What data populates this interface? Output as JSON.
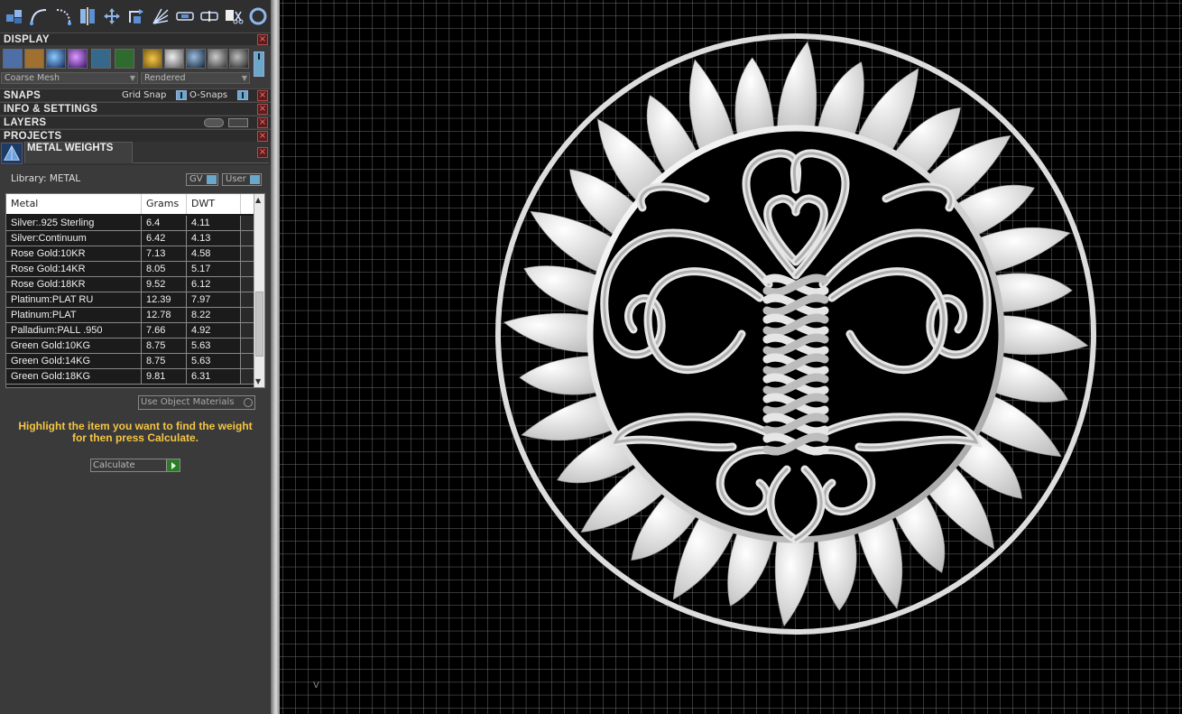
{
  "toolbar": {
    "icons": [
      "cubes-icon",
      "arc-icon",
      "curve-icon",
      "mirror-icon",
      "move-icon",
      "rotate-icon",
      "fan-icon",
      "link-icon",
      "unlink-icon",
      "scissors-icon",
      "circle-icon"
    ]
  },
  "display": {
    "title": "DISPLAY",
    "mesh_select": "Coarse Mesh",
    "render_select": "Rendered"
  },
  "snaps": {
    "title": "SNAPS",
    "grid_snap": "Grid Snap",
    "o_snaps": "O-Snaps"
  },
  "info": {
    "title": "INFO & SETTINGS"
  },
  "layers": {
    "title": "LAYERS"
  },
  "projects": {
    "title": "PROJECTS"
  },
  "metal_weights": {
    "title": "METAL WEIGHTS",
    "library_label": "Library: METAL",
    "gv_label": "GV",
    "user_label": "User",
    "columns": [
      "Metal",
      "Grams",
      "DWT"
    ],
    "rows": [
      {
        "metal": "Silver:.925 Sterling",
        "grams": "6.4",
        "dwt": "4.11"
      },
      {
        "metal": "Silver:Continuum",
        "grams": "6.42",
        "dwt": "4.13"
      },
      {
        "metal": "Rose Gold:10KR",
        "grams": "7.13",
        "dwt": "4.58"
      },
      {
        "metal": "Rose Gold:14KR",
        "grams": "8.05",
        "dwt": "5.17"
      },
      {
        "metal": "Rose Gold:18KR",
        "grams": "9.52",
        "dwt": "6.12"
      },
      {
        "metal": "Platinum:PLAT RU",
        "grams": "12.39",
        "dwt": "7.97"
      },
      {
        "metal": "Platinum:PLAT",
        "grams": "12.78",
        "dwt": "8.22"
      },
      {
        "metal": "Palladium:PALL .950",
        "grams": "7.66",
        "dwt": "4.92"
      },
      {
        "metal": "Green Gold:10KG",
        "grams": "8.75",
        "dwt": "5.63"
      },
      {
        "metal": "Green Gold:14KG",
        "grams": "8.75",
        "dwt": "5.63"
      },
      {
        "metal": "Green Gold:18KG",
        "grams": "9.81",
        "dwt": "6.31"
      }
    ],
    "use_object_materials": "Use Object Materials",
    "hint_line1": "Highlight the item you want to find the weight",
    "hint_line2": "for then press Calculate.",
    "calculate": "Calculate"
  },
  "viewport": {
    "axis_label": "V"
  },
  "colors": {
    "hint": "#f5c542",
    "grid": "#6f6f6f",
    "accent_toggle": "#6aa7c8"
  }
}
